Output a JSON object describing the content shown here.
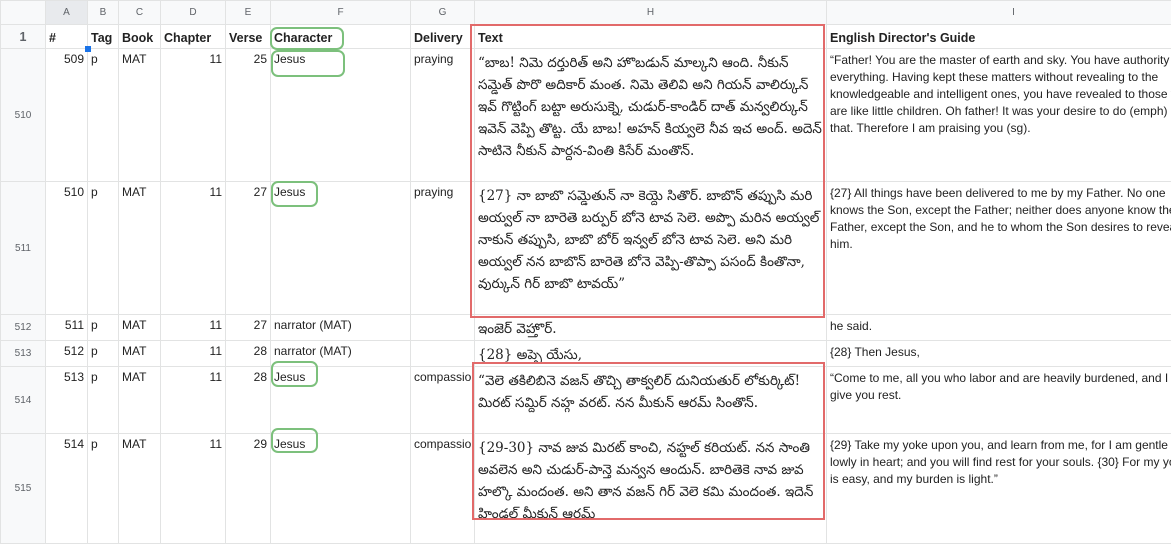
{
  "columns": [
    "",
    "A",
    "B",
    "C",
    "D",
    "E",
    "F",
    "G",
    "H",
    "I"
  ],
  "header_row": {
    "row_num": "1",
    "cells": [
      "#",
      "Tag",
      "Book",
      "Chapter",
      "Verse",
      "Character",
      "Delivery",
      "Text",
      "English Director's Guide"
    ]
  },
  "rows": [
    {
      "row_num": "510",
      "id": "509",
      "tag": "p",
      "book": "MAT",
      "chapter": "11",
      "verse": "25",
      "character": "Jesus",
      "delivery": "praying",
      "text": "“బాబ! నిమె దర్తురిత్ అని హొబడున్ మాల్కని ఆంది. నీకున్ సమ్డెత్ పొరొ అదికార్ మంత. నిమె తెలివి అని గియన్ వాలిర్కున్ ఇవ్ గొట్టింగ్ బట్టా అరుసుక్నె, చుడుర్-కాండిర్ దాత్ మన్వలిర్కున్ ఇవెన్ వెప్పి తొట్ట. యే బాబ! అహన్ కియ్వలె నీవ ఇచ అంద్. అదెన్ సాటినె నీకున్ పార్దన-వింతి కిసేర్ మంతొన్.",
      "english": "“Father! You are the master of earth and sky. You have authority over everything. Having kept these matters without revealing to the knowledgeable and intelligent ones, you have revealed to those who are like little children. Oh father! It was your desire to do (emph) like that. Therefore I am praising you (sg)."
    },
    {
      "row_num": "511",
      "id": "510",
      "tag": "p",
      "book": "MAT",
      "chapter": "11",
      "verse": "27",
      "character": "Jesus",
      "delivery": "praying",
      "text": "{27} నా బాబొ సమ్డెతున్ నా కెయ్దె సితొర్. బాబొన్ తప్పుసి మరి అయ్వల్ నా బారెతె బర్పుర్ బోనె టావ సెలె. అప్పొ మరిన అయ్వల్ నాకున్ తప్పుసి, బాబొ బోర్ ఇన్వల్ బోనె టావ సెలె. అని మరి అయ్వల్ నన బాబొన్ బారెతె బోనె వెప్పి-తొప్పా పసంద్ కింతొనా, వుర్కున్ గిర్ బాబొ టావయ్”",
      "english": "{27} All things have been delivered to me by my Father. No one knows the Son, except the Father; neither does anyone know the Father, except the Son, and he to whom the Son desires to reveal him."
    },
    {
      "row_num": "512",
      "id": "511",
      "tag": "p",
      "book": "MAT",
      "chapter": "11",
      "verse": "27",
      "character": "narrator (MAT)",
      "delivery": "",
      "text": "ఇంజెర్ వెహ్తొర్.",
      "english": "he said."
    },
    {
      "row_num": "513",
      "id": "512",
      "tag": "p",
      "book": "MAT",
      "chapter": "11",
      "verse": "28",
      "character": "narrator (MAT)",
      "delivery": "",
      "text": "{28} అప్పె యేసు,",
      "english": "{28} Then Jesus,"
    },
    {
      "row_num": "514",
      "id": "513",
      "tag": "p",
      "book": "MAT",
      "chapter": "11",
      "verse": "28",
      "character": "Jesus",
      "delivery": "compassio",
      "text": "“వెలె తకిలిబినె వజన్ తొచ్చి తాక్వలిర్ దునియతుర్ లోకుర్కిట్! మిరట్ సమ్దిర్ నహ్గ వరట్. నన మీకున్ ఆరమ్ సింతొన్.",
      "english": "“Come to me, all you who labor and are heavily burdened, and I will give you rest."
    },
    {
      "row_num": "515",
      "id": "514",
      "tag": "p",
      "book": "MAT",
      "chapter": "11",
      "verse": "29",
      "character": "Jesus",
      "delivery": "compassio",
      "text": "{29-30} నావ జువ మిరట్ కాంచి, నహ్టల్ కరియట్. నన సాంతి అవలెన అని చుడుర్-పాన్తె మన్వన ఆందున్. బారితెకె నావ జువ హల్కొ మందంత. అని తాన వజన్ గిర్ వెలె కమి మందంత. ఇదెన్ హిండల్ మీకున్ ఆరమ్",
      "english": "{29} Take my yoke upon you, and learn from me, for I am gentle and lowly in heart; and you will find rest for your souls. {30} For my yoke is easy, and my burden is light.”"
    }
  ]
}
